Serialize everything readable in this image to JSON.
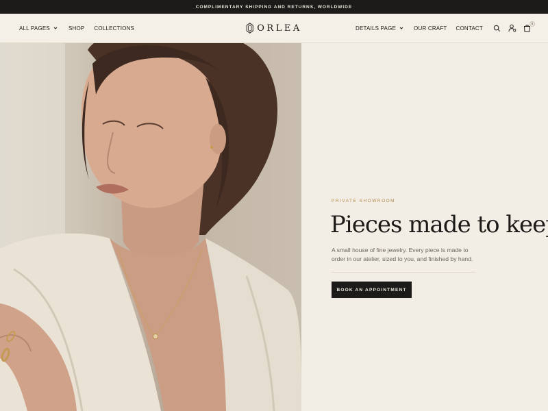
{
  "announcement": "COMPLIMENTARY SHIPPING AND RETURNS, WORLDWIDE",
  "header": {
    "nav_left": [
      {
        "label": "ALL PAGES",
        "dropdown": true
      },
      {
        "label": "SHOP",
        "dropdown": false
      },
      {
        "label": "COLLECTIONS",
        "dropdown": false
      }
    ],
    "logo": "ORLEA",
    "nav_right": [
      {
        "label": "DETAILS PAGE",
        "dropdown": true
      },
      {
        "label": "OUR CRAFT",
        "dropdown": false
      },
      {
        "label": "CONTACT",
        "dropdown": false
      }
    ],
    "icons": [
      "search-icon",
      "account-icon",
      "cart-icon"
    ],
    "cart_count": "0"
  },
  "hero": {
    "image": "woman-wearing-gold-necklace-photo",
    "eyebrow": "PRIVATE SHOWROOM",
    "headline": "Pieces made to keep.",
    "body": "A small house of fine jewelry. Every piece is made to order in our atelier, sized to you, and finished by hand.",
    "cta": "BOOK AN APPOINTMENT"
  },
  "colors": {
    "background": "#f3efe7",
    "announcement_bg": "#1c1b19",
    "accent_gold": "#b0894a",
    "button_bg": "#1c1b19"
  }
}
